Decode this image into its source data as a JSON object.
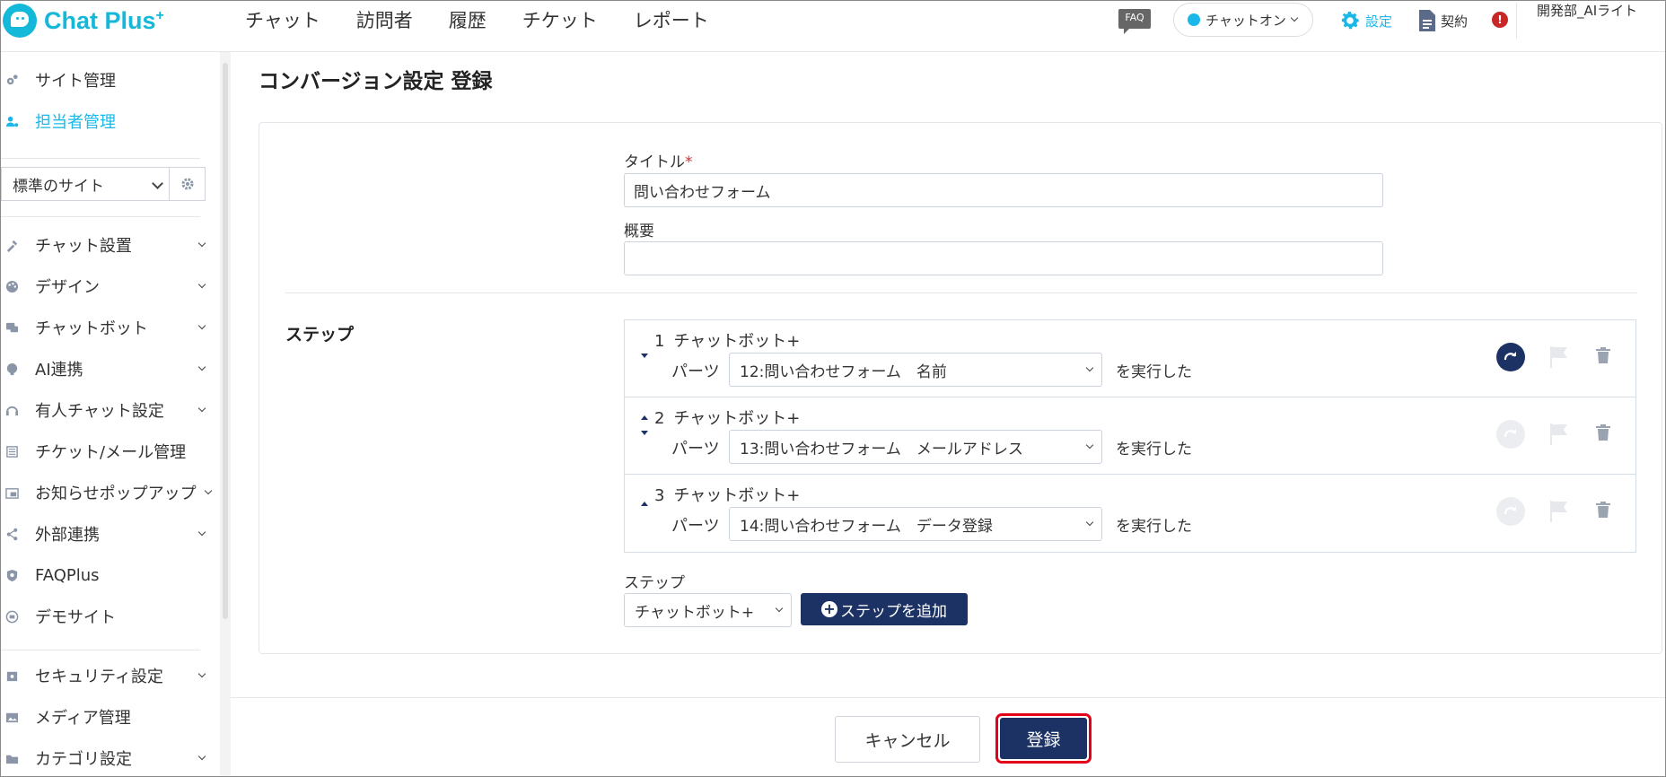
{
  "app": {
    "logo_text": "Chat Plus",
    "logo_plus": "+",
    "brand_color": "#14b8d8",
    "accent_color": "#1c3264"
  },
  "header": {
    "nav": [
      "チャット",
      "訪問者",
      "履歴",
      "チケット",
      "レポート"
    ],
    "faq_label": "FAQ",
    "status_label": "チャットオン",
    "settings_label": "設定",
    "contract_label": "契約",
    "alert_symbol": "!",
    "user_name": "開発部_AIライト"
  },
  "sidebar": {
    "top_items": [
      {
        "label": "サイト管理",
        "icon": "gears-icon"
      },
      {
        "label": "担当者管理",
        "icon": "user-gear-icon",
        "active": true
      }
    ],
    "site_select": "標準のサイト",
    "items": [
      {
        "label": "チャット設置",
        "icon": "tools-icon"
      },
      {
        "label": "デザイン",
        "icon": "palette-icon"
      },
      {
        "label": "チャットボット",
        "icon": "comments-icon"
      },
      {
        "label": "AI連携",
        "icon": "brain-icon"
      },
      {
        "label": "有人チャット設定",
        "icon": "headset-icon"
      },
      {
        "label": "チケット/メール管理",
        "icon": "list-icon"
      },
      {
        "label": "お知らせポップアップ",
        "icon": "window-icon"
      },
      {
        "label": "外部連携",
        "icon": "share-icon"
      },
      {
        "label": "FAQPlus",
        "icon": "shield-icon"
      },
      {
        "label": "デモサイト",
        "icon": "monitor-icon"
      }
    ],
    "bottom_items": [
      {
        "label": "セキュリティ設定",
        "icon": "lock-icon"
      },
      {
        "label": "メディア管理",
        "icon": "image-icon"
      },
      {
        "label": "カテゴリ設定",
        "icon": "folder-icon"
      }
    ]
  },
  "main": {
    "page_title": "コンバージョン設定 登録",
    "title_label": "タイトル",
    "required_mark": "*",
    "title_value": "問い合わせフォーム",
    "summary_label": "概要",
    "summary_value": "",
    "steps_label": "ステップ",
    "steps": [
      {
        "num": "1",
        "type": "チャットボット+",
        "parts_label": "パーツ",
        "part": "12:問い合わせフォーム　名前",
        "suffix": "を実行した",
        "redo_active": true
      },
      {
        "num": "2",
        "type": "チャットボット+",
        "parts_label": "パーツ",
        "part": "13:問い合わせフォーム　メールアドレス",
        "suffix": "を実行した",
        "redo_active": false
      },
      {
        "num": "3",
        "type": "チャットボット+",
        "parts_label": "パーツ",
        "part": "14:問い合わせフォーム　データ登録",
        "suffix": "を実行した",
        "redo_active": false
      }
    ],
    "add_step_label": "ステップ",
    "add_step_select": "チャットボット+",
    "add_step_button": "ステップを追加",
    "cancel_button": "キャンセル",
    "submit_button": "登録"
  }
}
